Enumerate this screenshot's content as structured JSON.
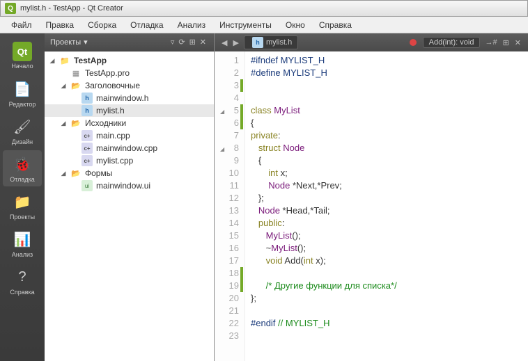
{
  "window": {
    "title": "mylist.h - TestApp - Qt Creator"
  },
  "menu": [
    "Файл",
    "Правка",
    "Сборка",
    "Отладка",
    "Анализ",
    "Инструменты",
    "Окно",
    "Справка"
  ],
  "sidebar": [
    {
      "label": "Начало",
      "glyph": "Qt",
      "color": "#74a928"
    },
    {
      "label": "Редактор",
      "glyph": "📄",
      "color": ""
    },
    {
      "label": "Дизайн",
      "glyph": "🖌",
      "color": ""
    },
    {
      "label": "Отладка",
      "glyph": "🐞",
      "color": "",
      "selected": true
    },
    {
      "label": "Проекты",
      "glyph": "📁",
      "color": ""
    },
    {
      "label": "Анализ",
      "glyph": "📊",
      "color": ""
    },
    {
      "label": "Справка",
      "glyph": "?",
      "color": ""
    }
  ],
  "projectPanel": {
    "title": "Проекты"
  },
  "tree": {
    "root": "TestApp",
    "pro": "TestApp.pro",
    "headersFolder": "Заголовочные",
    "headers": [
      "mainwindow.h",
      "mylist.h"
    ],
    "sourcesFolder": "Исходники",
    "sources": [
      "main.cpp",
      "mainwindow.cpp",
      "mylist.cpp"
    ],
    "formsFolder": "Формы",
    "forms": [
      "mainwindow.ui"
    ],
    "selected": "mylist.h"
  },
  "editor": {
    "openFile": "mylist.h",
    "symbol": "Add(int): void",
    "lines": [
      {
        "n": 1,
        "html": "<span class='kw-pre'>#ifndef</span> <span class='kw-macro'>MYLIST_H</span>"
      },
      {
        "n": 2,
        "html": "<span class='kw-pre'>#define</span> <span class='kw-macro'>MYLIST_H</span>"
      },
      {
        "n": 3,
        "html": "",
        "marked": true
      },
      {
        "n": 4,
        "html": ""
      },
      {
        "n": 5,
        "html": "<span class='kw-keyword'>class</span> <span class='kw-class'>MyList</span>",
        "fold": true,
        "marked": true
      },
      {
        "n": 6,
        "html": "{",
        "marked": true
      },
      {
        "n": 7,
        "html": "<span class='kw-keyword'>private</span>:"
      },
      {
        "n": 8,
        "html": "   <span class='kw-keyword'>struct</span> <span class='kw-class'>Node</span>",
        "fold": true
      },
      {
        "n": 9,
        "html": "   {"
      },
      {
        "n": 10,
        "html": "       <span class='kw-type'>int</span> x;"
      },
      {
        "n": 11,
        "html": "       <span class='kw-class'>Node</span> *Next,*Prev;"
      },
      {
        "n": 12,
        "html": "   };"
      },
      {
        "n": 13,
        "html": "   <span class='kw-class'>Node</span> *Head,*Tail;"
      },
      {
        "n": 14,
        "html": "   <span class='kw-keyword'>public</span>:"
      },
      {
        "n": 15,
        "html": "      <span class='kw-class'>MyList</span>();"
      },
      {
        "n": 16,
        "html": "      ~<span class='kw-class'>MyList</span>();"
      },
      {
        "n": 17,
        "html": "      <span class='kw-type'>void</span> Add(<span class='kw-type'>int</span> x);"
      },
      {
        "n": 18,
        "html": "",
        "marked": true
      },
      {
        "n": 19,
        "html": "      <span class='kw-comment'>/* Другие функции для списка*/</span>",
        "marked": true
      },
      {
        "n": 20,
        "html": "};"
      },
      {
        "n": 21,
        "html": ""
      },
      {
        "n": 22,
        "html": "<span class='kw-pre'>#endif</span> <span class='kw-comment'>// MYLIST_H</span>"
      },
      {
        "n": 23,
        "html": ""
      }
    ]
  }
}
